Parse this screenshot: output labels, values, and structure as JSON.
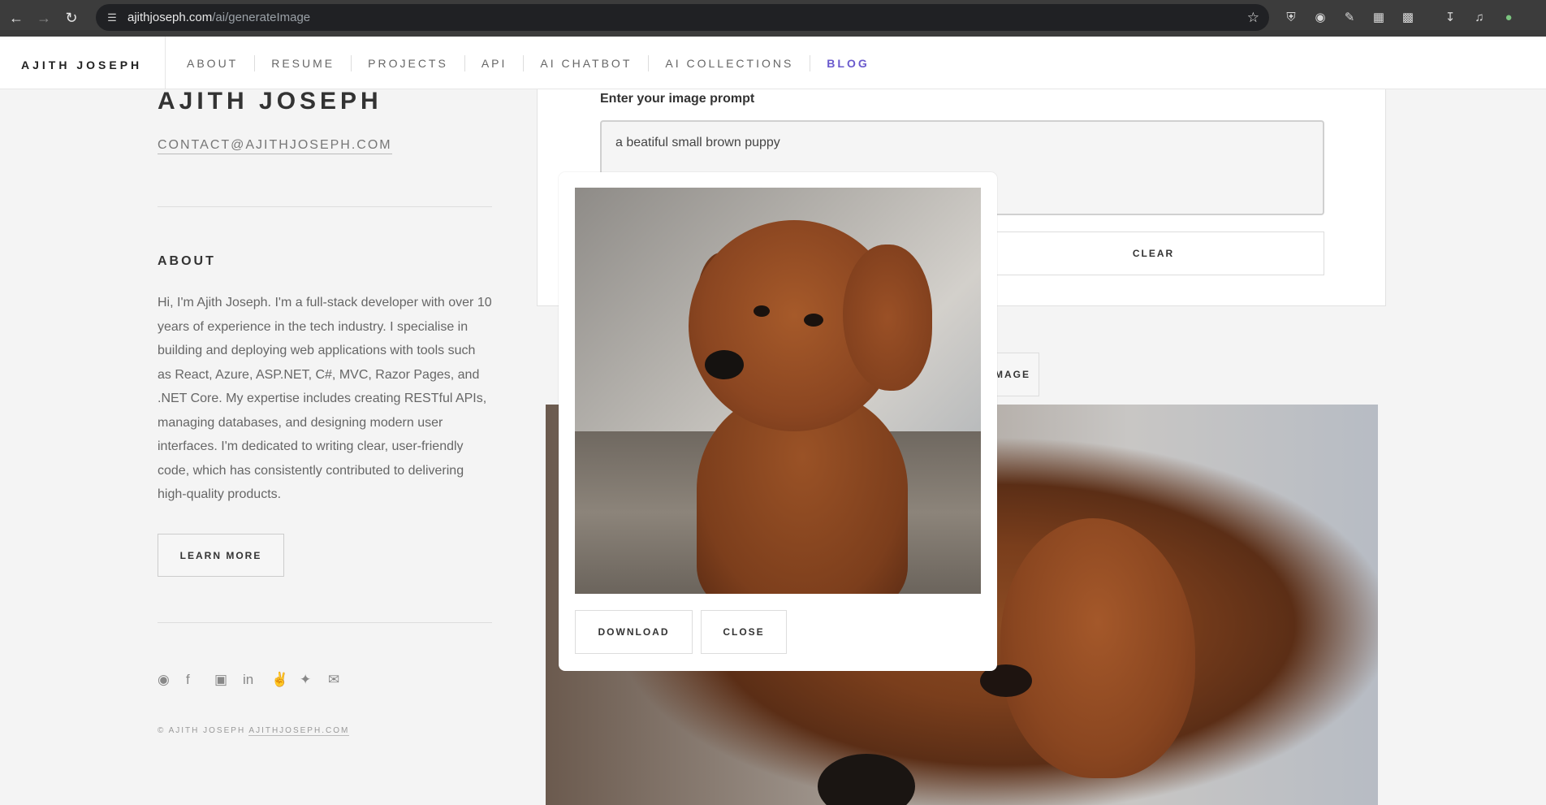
{
  "browser": {
    "url_host": "ajithjoseph.com",
    "url_path": "/ai/generateImage"
  },
  "header": {
    "brand": "AJITH JOSEPH",
    "nav": [
      "ABOUT",
      "RESUME",
      "PROJECTS",
      "API",
      "AI CHATBOT",
      "AI COLLECTIONS",
      "BLOG"
    ],
    "active_nav": "BLOG",
    "accent_color": "#6a5acd"
  },
  "sidebar": {
    "name": "AJITH JOSEPH",
    "email": "CONTACT@AJITHJOSEPH.COM",
    "about_heading": "ABOUT",
    "about_text": "Hi, I'm Ajith Joseph. I'm a full-stack developer with over 10 years of experience in the tech industry. I specialise in building and deploying web applications with tools such as React, Azure, ASP.NET, C#, MVC, Razor Pages, and .NET Core. My expertise includes creating RESTful APIs, managing databases, and designing modern user interfaces. I'm dedicated to writing clear, user-friendly code, which has consistently contributed to delivering high-quality products.",
    "learn_more": "LEARN MORE",
    "socials": [
      "github-icon",
      "facebook-icon",
      "instagram-icon",
      "linkedin-icon",
      "peace-icon",
      "twitter-icon",
      "mail-icon"
    ],
    "copyright_prefix": "© AJITH JOSEPH",
    "copyright_link": "AJITHJOSEPH.COM"
  },
  "form": {
    "prompt_label": "Enter your image prompt",
    "prompt_value": "a beatiful small brown puppy",
    "clear_label": "CLEAR",
    "generate_label_partial": "MAGE"
  },
  "modal": {
    "download_label": "DOWNLOAD",
    "close_label": "CLOSE"
  }
}
